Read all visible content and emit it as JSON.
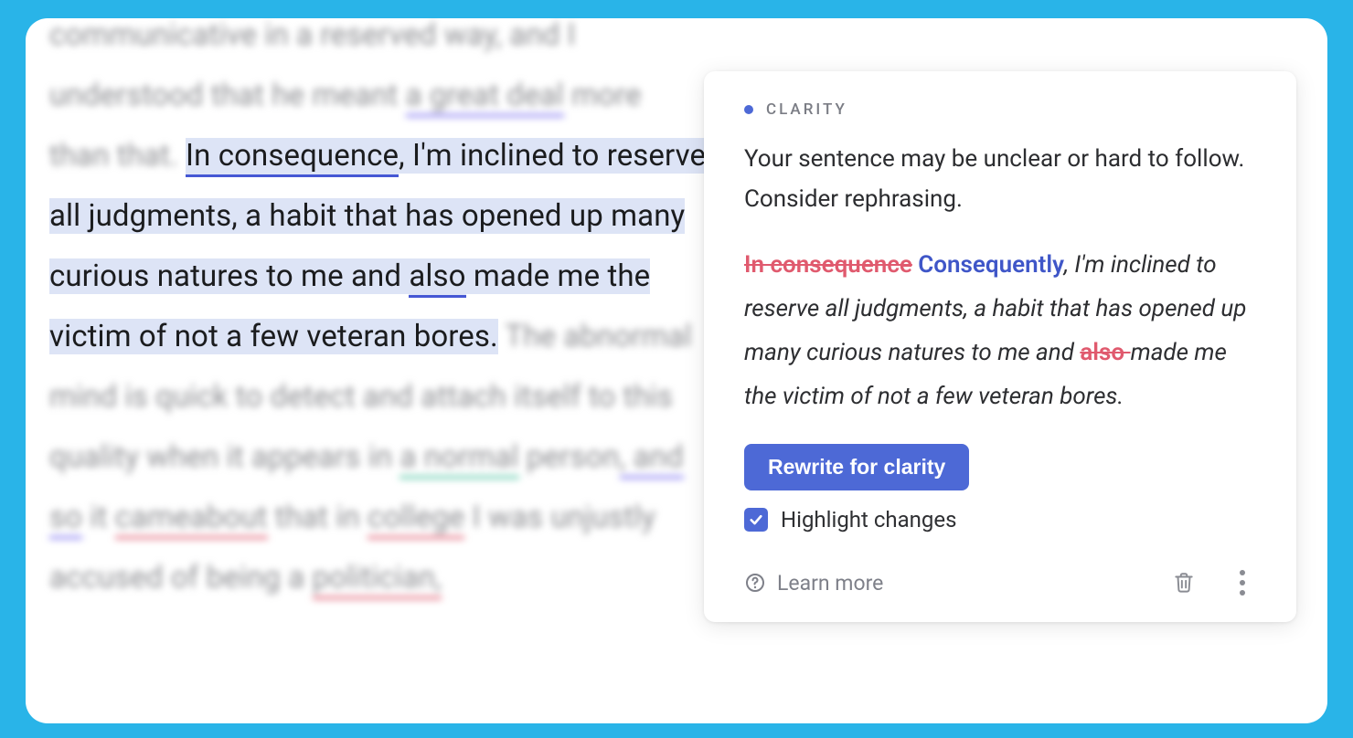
{
  "document": {
    "pre_blur_1": "communicative in a reserved way, and I understood that he meant ",
    "pre_blur_underlined": "a great deal",
    "pre_blur_2": " more than that. ",
    "hl_part1": "In consequence",
    "hl_part2": ", I'm inclined to reserve all judgments, a habit that has opened up many curious natures to me and ",
    "hl_also": "also",
    "hl_part3": " made me the victim of not a few veteran bores.",
    "post_blur_1": " The abnormal mind is quick to detect and attach itself to this quality when it appears in ",
    "post_normal": "a normal",
    "post_blur_2": " person",
    "post_andso": ", and so",
    "post_blur_3": " it ",
    "post_cameabout": "cameabout",
    "post_blur_4": " that in ",
    "post_college": "college",
    "post_blur_5": " I was unjustly accused of being a ",
    "post_politician": "politician,"
  },
  "suggestion": {
    "category": "CLARITY",
    "description": "Your sentence may be unclear or hard to follow. Consider rephrasing.",
    "rewrite": {
      "strike1": "In consequence",
      "insert1": "Consequently",
      "mid": ", I'm inclined to reserve all judgments, a habit that has opened up many curious natures to me and ",
      "strike2": "also ",
      "tail": "made me the victim of not a few veteran bores."
    },
    "button_label": "Rewrite for clarity",
    "highlight_label": "Highlight changes",
    "highlight_checked": true,
    "learn_more_label": "Learn more"
  },
  "colors": {
    "accent": "#4d69d6",
    "strike": "#e05a6e",
    "insert": "#3f56c8"
  }
}
